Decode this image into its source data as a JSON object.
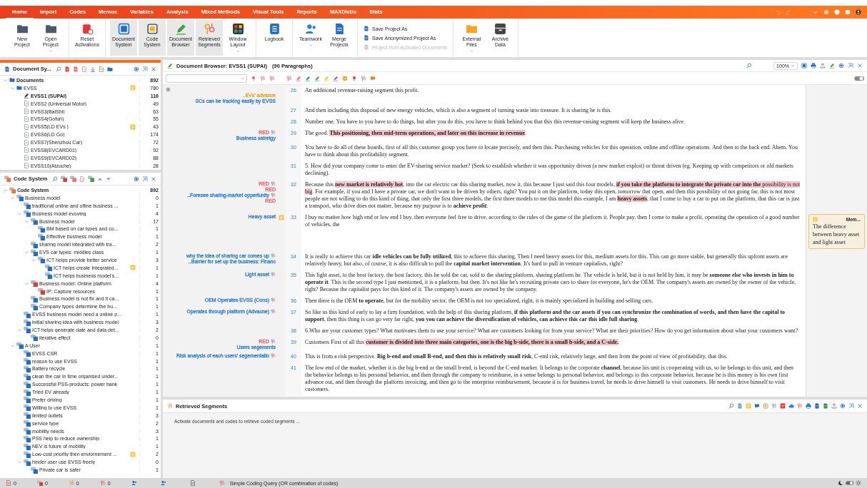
{
  "menu": {
    "tabs": [
      {
        "label": "Home",
        "selected": true
      },
      {
        "label": "Import",
        "selected": false
      },
      {
        "label": "Codes",
        "selected": false
      },
      {
        "label": "Memos",
        "selected": false
      },
      {
        "label": "Variables",
        "selected": false
      },
      {
        "label": "Analysis",
        "selected": false
      },
      {
        "label": "Mixed Methods",
        "selected": false
      },
      {
        "label": "Visual Tools",
        "selected": false
      },
      {
        "label": "Reports",
        "selected": false
      },
      {
        "label": "MAXDictio",
        "selected": false
      },
      {
        "label": "Stats",
        "selected": false
      }
    ]
  },
  "ribbon": {
    "groups": [
      {
        "kind": "large",
        "items": [
          {
            "label": "New Project",
            "dropdown": false
          },
          {
            "label": "Open Project",
            "dropdown": true
          }
        ]
      },
      {
        "kind": "large",
        "items": [
          {
            "label": "Reset Activations",
            "dropdown": false
          }
        ]
      },
      {
        "kind": "large",
        "items": [
          {
            "label": "Document System",
            "dropdown": false,
            "selected": true
          },
          {
            "label": "Code System",
            "dropdown": false,
            "selected": true
          },
          {
            "label": "Document Browser",
            "dropdown": false,
            "selected": true
          },
          {
            "label": "Retrieved Segments",
            "dropdown": false,
            "selected": true
          },
          {
            "label": "Window Layout",
            "dropdown": true,
            "selected": false
          }
        ]
      },
      {
        "kind": "large",
        "items": [
          {
            "label": "Logbook",
            "dropdown": false
          }
        ]
      },
      {
        "kind": "large",
        "items": [
          {
            "label": "Teamwork",
            "dropdown": true
          },
          {
            "label": "Merge Projects",
            "dropdown": false
          }
        ]
      },
      {
        "kind": "stack",
        "items": [
          {
            "label": "Save Project As",
            "disabled": false
          },
          {
            "label": "Save Anonymized Project As",
            "disabled": false
          },
          {
            "label": "Project from Activated Documents",
            "disabled": true
          }
        ]
      },
      {
        "kind": "large",
        "items": [
          {
            "label": "External Files",
            "dropdown": true
          },
          {
            "label": "Archive Data",
            "dropdown": false
          }
        ]
      }
    ]
  },
  "document_system": {
    "title": "Document Sy...",
    "tree": [
      {
        "kind": "root",
        "label": "Documents",
        "count": "892",
        "memo": false,
        "expanded": true,
        "children": [
          {
            "kind": "folder",
            "label": "EVSS",
            "count": "780",
            "memo": true,
            "expanded": true,
            "children": [
              {
                "kind": "document",
                "label": "EVSS1 (SUPAI)",
                "count": "116",
                "memo": false,
                "selected": true
              },
              {
                "kind": "document",
                "label": "EVSS2 (Universal Motor)",
                "count": "49",
                "memo": false,
                "selected": false
              },
              {
                "kind": "document",
                "label": "EVSS3(BaiShi)",
                "count": "63",
                "memo": false,
                "selected": false
              },
              {
                "kind": "document",
                "label": "EVSS4(Gofun)",
                "count": "55",
                "memo": false,
                "selected": false
              },
              {
                "kind": "document",
                "label": "EVSS5(LD EVs )",
                "count": "43",
                "memo": true,
                "selected": false
              },
              {
                "kind": "document",
                "label": "EVSS6(LD Go)",
                "count": "174",
                "memo": false,
                "selected": false
              },
              {
                "kind": "document",
                "label": "EVSS7(Shenzhou Car)",
                "count": "72",
                "memo": false,
                "selected": false
              },
              {
                "kind": "document",
                "label": "EVSS8(EVCARD01)",
                "count": "92",
                "memo": false,
                "selected": false
              },
              {
                "kind": "document",
                "label": "EVSS9(EVCARD02)",
                "count": "88",
                "memo": false,
                "selected": false
              },
              {
                "kind": "document",
                "label": "EVSS10(Atzuche)",
                "count": "28",
                "memo": false,
                "selected": false
              }
            ]
          }
        ]
      }
    ]
  },
  "code_system": {
    "title": "Code System",
    "tree": [
      {
        "kind": "root",
        "label": "Code System",
        "count": "892",
        "memo": false,
        "expanded": true,
        "children": [
          {
            "kind": "code",
            "color": "#1e6fd0",
            "label": "Business model",
            "count": "0",
            "memo": false,
            "expanded": true,
            "children": [
              {
                "kind": "code",
                "color": "#1e6fd0",
                "label": "traditional online and ofline business ...",
                "count": "1",
                "memo": false
              },
              {
                "kind": "code",
                "color": "#1e6fd0",
                "label": "Business model evoving",
                "count": "4",
                "memo": false,
                "expanded": true,
                "children": [
                  {
                    "kind": "code",
                    "color": "#1e6fd0",
                    "label": "Business model",
                    "count": "17",
                    "memo": false,
                    "expanded": true,
                    "children": [
                      {
                        "kind": "code",
                        "color": "#1e6fd0",
                        "label": "BM based on car types and co...",
                        "count": "1",
                        "memo": false
                      },
                      {
                        "kind": "code",
                        "color": "#1e6fd0",
                        "label": "Effective business model",
                        "count": "1",
                        "memo": false
                      }
                    ]
                  },
                  {
                    "kind": "code",
                    "color": "#1e6fd0",
                    "label": "sharing model integrated with tra...",
                    "count": "2",
                    "memo": false
                  },
                  {
                    "kind": "code",
                    "color": "#1e6fd0",
                    "label": "EVS car types: middles class",
                    "count": "1",
                    "memo": false,
                    "expanded": true,
                    "children": [
                      {
                        "kind": "code",
                        "color": "#1e6fd0",
                        "label": "ICT helps provide better service",
                        "count": "3",
                        "memo": false,
                        "expanded": true,
                        "children": [
                          {
                            "kind": "code",
                            "color": "#1e6fd0",
                            "label": "ICT helps create Integrated...",
                            "count": "1",
                            "memo": true
                          },
                          {
                            "kind": "code",
                            "color": "#1e6fd0",
                            "label": "ICT helps business model's...",
                            "count": "1",
                            "memo": false
                          }
                        ]
                      }
                    ]
                  },
                  {
                    "kind": "code",
                    "color": "#e53935",
                    "label": "Business model: Online platform",
                    "count": "4",
                    "memo": false,
                    "expanded": true,
                    "children": [
                      {
                        "kind": "code",
                        "color": "#e53935",
                        "label": "IP: Capture resources",
                        "count": "1",
                        "memo": false
                      }
                    ]
                  },
                  {
                    "kind": "code",
                    "color": "#1e6fd0",
                    "label": "Business model is not fix and it ca...",
                    "count": "1",
                    "memo": false
                  },
                  {
                    "kind": "code",
                    "color": "#1e6fd0",
                    "label": "Company types determine the bu...",
                    "count": "1",
                    "memo": false
                  }
                ]
              },
              {
                "kind": "code",
                "color": "#1e6fd0",
                "label": "EVSS business model need a online p...",
                "count": "1",
                "memo": false
              },
              {
                "kind": "code",
                "color": "#1e6fd0",
                "label": "initial sharing idea with business model",
                "count": "3",
                "memo": false
              },
              {
                "kind": "code",
                "color": "#1e6fd0",
                "label": "ICT helps generate date and data det...",
                "count": "2",
                "memo": false,
                "expanded": true,
                "children": [
                  {
                    "kind": "code",
                    "color": "#1e6fd0",
                    "label": "iterative effect",
                    "count": "0",
                    "memo": false
                  }
                ]
              }
            ]
          },
          {
            "kind": "code",
            "color": "#1e6fd0",
            "label": "A User",
            "count": "1",
            "memo": false,
            "expanded": true,
            "children": [
              {
                "kind": "code",
                "color": "#1e6fd0",
                "label": "EVSS CSR",
                "count": "1",
                "memo": false
              },
              {
                "kind": "code",
                "color": "#1e6fd0",
                "label": "reason to use EVSS",
                "count": "1",
                "memo": false
              },
              {
                "kind": "code",
                "color": "#1e6fd0",
                "label": "Battery recycle",
                "count": "1",
                "memo": false
              },
              {
                "kind": "code",
                "color": "#1e6fd0",
                "label": "clean the car in time organised under...",
                "count": "1",
                "memo": false
              },
              {
                "kind": "code",
                "color": "#1e6fd0",
                "label": "Successful PSS-products: power bank",
                "count": "1",
                "memo": false
              },
              {
                "kind": "code",
                "color": "#1e6fd0",
                "label": "Tried EV already",
                "count": "1",
                "memo": false
              },
              {
                "kind": "code",
                "color": "#1e6fd0",
                "label": "Prefer driving",
                "count": "1",
                "memo": false
              },
              {
                "kind": "code",
                "color": "#1e6fd0",
                "label": "Willing to use EVSS",
                "count": "1",
                "memo": false
              },
              {
                "kind": "code",
                "color": "#1e6fd0",
                "label": "limited outlets",
                "count": "3",
                "memo": false
              },
              {
                "kind": "code",
                "color": "#1e6fd0",
                "label": "service type",
                "count": "2",
                "memo": false
              },
              {
                "kind": "code",
                "color": "#1e6fd0",
                "label": "mobility needs",
                "count": "3",
                "memo": false
              },
              {
                "kind": "code",
                "color": "#1e6fd0",
                "label": "PSS help to reduce ownership",
                "count": "1",
                "memo": false
              },
              {
                "kind": "code",
                "color": "#1e6fd0",
                "label": "NEV is future of mobility",
                "count": "1",
                "memo": false
              },
              {
                "kind": "code",
                "color": "#1e6fd0",
                "label": "Low-cost priority then enviornement ...",
                "count": "2",
                "memo": true
              },
              {
                "kind": "code",
                "color": "#1e6fd0",
                "label": "hinder user use EVSS freely",
                "count": "0",
                "memo": false,
                "expanded": true,
                "children": [
                  {
                    "kind": "code",
                    "color": "#1e6fd0",
                    "label": "Private car is safer",
                    "count": "1",
                    "memo": false
                  }
                ]
              }
            ]
          }
        ]
      }
    ]
  },
  "document_browser": {
    "title": "Document Browser: EVSS1 (SUPAI)",
    "paragraph_count": "(90 Paragraphs)",
    "zoom": "100%",
    "paragraphs": [
      {
        "number": "26",
        "memo": false,
        "margin": [
          {
            "text": "..EVs' advance",
            "color": "#e8a317",
            "marker": false
          },
          {
            "text": "SCs can be tracking easily by EVSS",
            "color": "#2f7fc1",
            "marker": false
          }
        ],
        "runs": [
          {
            "text": "An additional revenue-raising segment this profit.",
            "highlight": false
          }
        ]
      },
      {
        "number": "27",
        "memo": false,
        "runs": [
          {
            "text": "And then including this disposal of new energy vehicles, which is also a segment of turning waste into treasure. It is sharing he is this.",
            "highlight": false
          }
        ]
      },
      {
        "number": "28",
        "memo": false,
        "runs": [
          {
            "text": "Number one. You have to you have to do things, but after you do this, you have to think behind you that this this revenue-raising segment will keep the business alive.",
            "highlight": false
          }
        ]
      },
      {
        "number": "29",
        "memo": false,
        "margin": [
          {
            "text": "RED",
            "color": "#f0616d",
            "marker": true
          },
          {
            "text": "Business satretgy",
            "color": "#2f7fc1",
            "marker": false
          }
        ],
        "runs": [
          {
            "text": "The good. ",
            "highlight": false
          },
          {
            "text": "**This positioning, then mid-term operations, and later on this increase in revenue**",
            "highlight": true
          },
          {
            "text": ".",
            "highlight": false
          }
        ]
      },
      {
        "number": "30",
        "memo": false,
        "runs": [
          {
            "text": "You have to do all of these boards, first of all this customer group you have to locate precisely, and then this. Purchasing vehicles for this operation, online and offline operations. And then to the back end. Ahem. You have to think about this profitability segment.",
            "highlight": false
          }
        ]
      },
      {
        "number": "31",
        "memo": false,
        "runs": [
          {
            "text": "5. How did your company come to enter the EV-sharing service market? (Seek to establish whether it was opportunity driven (a new market exploit) or threat driven (eg. Keeping up with competitors or old markets declining).",
            "highlight": false
          }
        ]
      },
      {
        "number": "32",
        "memo": false,
        "margin": [
          {
            "text": "RED",
            "color": "#f0616d",
            "marker": true
          },
          {
            "text": "RED",
            "color": "#f0616d",
            "marker": false
          },
          {
            "text": "..Foresee sharing-market oppertunity",
            "color": "#2f7fc1",
            "marker": true
          },
          {
            "text": "RED",
            "color": "#f0616d",
            "marker": false
          }
        ],
        "runs": [
          {
            "text": "Because this ",
            "highlight": false
          },
          {
            "text": "**new market is relatively hot**",
            "highlight": true
          },
          {
            "text": ", into the car electric car this sharing market, now it, this because I just said this four models, ",
            "highlight": false
          },
          {
            "text": "**if you take the platform to integrate the private car into the** possibility is not big",
            "highlight": true
          },
          {
            "text": ". For example, if you and I have a private car, we don't want to be driven by others, right? You put it on the platform, today this open, tomorrow that open, and then this possibility of not going far, this is not most people are not willing to do this kind of thing, that only the first three models, the first three models to me this model this example, I am ",
            "highlight": false
          },
          {
            "text": "**heavy assets**",
            "highlight": true
          },
          {
            "text": ", that I come to buy a car to put on the platform, that this car is just a transport, who drive does not matter, because my purpose is to **achieve profit**.",
            "highlight": false
          }
        ]
      },
      {
        "number": "33",
        "memo": true,
        "note": {
          "title": "Mem...",
          "text": "The difference between heavy asset and light asset"
        },
        "margin": [
          {
            "text": "Heavy asset",
            "color": "#2f7fc1",
            "marker": false
          }
        ],
        "runs": [
          {
            "text": "I buy no matter how high end or low end I buy, then everyone feel free to drive, according to the rules of the game of the platform it. People pay, then I come to make a profit, operating the operation of a good number of vehicles, the",
            "highlight": false
          }
        ]
      },
      {
        "number": "34",
        "memo": false,
        "margin": [
          {
            "text": "why the idea of sharing car comes up",
            "color": "#2f7fc1",
            "marker": true
          },
          {
            "text": "..Barrier for set up the business: Financ",
            "color": "#2f7fc1",
            "marker": false
          }
        ],
        "runs": [
          {
            "text": "It is really to achieve this car **idle vehicles can be fully utilized**, this to achieve this sharing. Then I need heavy assets for this, medium assets for this. This can go more stable, but generally this upfront assets are relatively heavy, but also, of course, it is also difficult to pull the **capital market intervention**. It's hard to pull in venture capitalists, right?",
            "highlight": false
          }
        ]
      },
      {
        "number": "35",
        "memo": false,
        "margin": [
          {
            "text": "Light asset",
            "color": "#2f7fc1",
            "marker": true
          }
        ],
        "runs": [
          {
            "text": "This light asset, to the host factory, the host factory, this he sold the car, sold to the sharing platform, sharing platform he. The vehicle is held, but it is not held by him, it may be **someone else who invests in him to operate it**. This is the second type I just mentioned, it is a platform, but then. It's not like he's recruiting private cars to share for everyone, he's the OEM. The company's assets are owned by the owner of the vehicle, right? Because the capitalist pays for this kind of it. The company's assets are owned by the company.",
            "highlight": false
          }
        ]
      },
      {
        "number": "36",
        "memo": false,
        "margin": [
          {
            "text": "OEM Operates EVSS (Cons)",
            "color": "#2f7fc1",
            "marker": true
          }
        ],
        "runs": [
          {
            "text": "Then there is the OEM **to operate**, but for the mobility sector, the OEM is not too specialized, right, it is mainly specialized in building and selling cars.",
            "highlight": false
          }
        ]
      },
      {
        "number": "37",
        "memo": false,
        "margin": [
          {
            "text": "Operates through platform (Advacne)",
            "color": "#2f7fc1",
            "marker": true
          }
        ],
        "runs": [
          {
            "text": "So like us this kind of early to lay a firm foundation, with the help of this sharing platform, **if this platform and the car assets if you can synchronize the combination of words, and then have the capital to support**, then this thing is can go very far right, **you you can achieve the diversification of vehicles, can achieve this car this idle full sharing**.",
            "highlight": false
          }
        ]
      },
      {
        "number": "38",
        "memo": false,
        "runs": [
          {
            "text": "6.Who are your customer types? What motivates them to use your service? What are customers looking for from your service? What are their priorities? How do you get information about what your customers want?",
            "highlight": false
          }
        ]
      },
      {
        "number": "39",
        "memo": false,
        "margin": [
          {
            "text": "RED",
            "color": "#f0616d",
            "marker": true
          },
          {
            "text": "Users segements",
            "color": "#2f7fc1",
            "marker": false
          }
        ],
        "runs": [
          {
            "text": "Customers First of all this ",
            "highlight": false
          },
          {
            "text": "**customer is divided into three main categories, one is the big b-side, there is a small b-side, and a C-side.**",
            "highlight": true
          }
        ]
      },
      {
        "number": "40",
        "memo": false,
        "margin": [
          {
            "text": "Risk analysis of each users' segementatio",
            "color": "#2f7fc1",
            "marker": true
          }
        ],
        "runs": [
          {
            "text": "This is from a risk perspective. **Big b-end and small B-end, and then this is relatively small risk**, C-end risk, relatively large, and then from the point of view of profitability, that this.",
            "highlight": false
          }
        ]
      },
      {
        "number": "41",
        "memo": false,
        "runs": [
          {
            "text": "The low end of the market, whether it is the big b-end or the small b-end, is beyond the C-end market. It belongs to the corporate **channel**, because his unit is cooperating with us, so he belongs to this unit, and then the behavior belongs to his personal behavior, and then through the company to reimburse, in a sense belongs to personal behavior, and belongs to this corporate behavior, because he is this money is his own first advance out, and then through the platform invoicing, and then go to the enterprise reimbursement, because it is for business travel, he needs to drive himself to visit customers. He needs to drive himself to visit customers.",
            "highlight": false
          }
        ]
      }
    ]
  },
  "retrieved_segments": {
    "title": "Retrieved Segments",
    "message": "Activate documents and codes to retrieve coded segments ..."
  },
  "status_bar": {
    "counts": [
      "0",
      "0",
      "0",
      "0"
    ],
    "query": "Simple Coding Query (OR combination of codes)"
  }
}
